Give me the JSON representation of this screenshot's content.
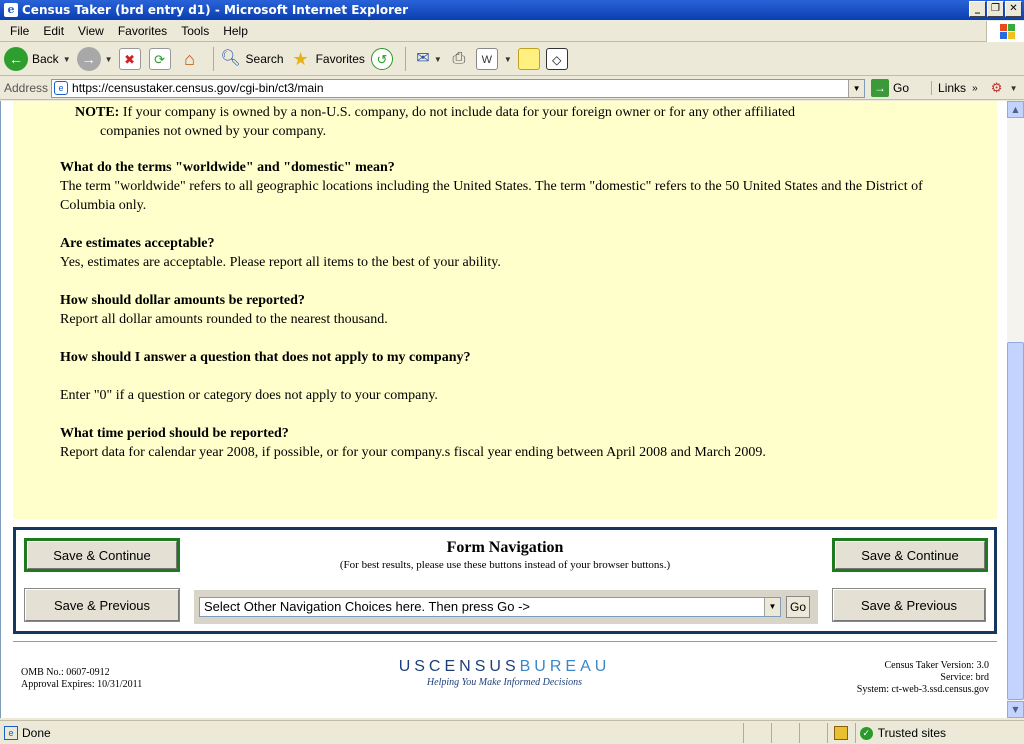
{
  "window": {
    "title": "Census Taker (brd entry d1) - Microsoft Internet Explorer",
    "controls": {
      "minimize": "_",
      "restore": "❐",
      "close": "✕"
    }
  },
  "menu": [
    {
      "label": "File"
    },
    {
      "label": "Edit"
    },
    {
      "label": "View"
    },
    {
      "label": "Favorites"
    },
    {
      "label": "Tools"
    },
    {
      "label": "Help"
    }
  ],
  "toolbar": {
    "back": "Back",
    "search": "Search",
    "favorites": "Favorites"
  },
  "address": {
    "label": "Address",
    "url": "https://censustaker.census.gov/cgi-bin/ct3/main",
    "go": "Go",
    "links": "Links"
  },
  "content": {
    "note_label": "NOTE:",
    "note_text": "If your company is owned by a non-U.S. company, do not include data for your foreign owner or for any other affiliated",
    "note_text2": "companies not owned by your company.",
    "qa": [
      {
        "q": "What do the terms \"worldwide\" and \"domestic\" mean?",
        "a": "The term \"worldwide\" refers to all geographic locations including the United States. The term \"domestic\" refers to the 50 United States and the District of Columbia only."
      },
      {
        "q": "Are estimates acceptable?",
        "a": "Yes, estimates are acceptable. Please report all items to the best of your ability."
      },
      {
        "q": "How should dollar amounts be reported?",
        "a": "Report all dollar amounts rounded to the nearest thousand."
      },
      {
        "q": "How should I answer a question that does not apply to my company?",
        "a": "Enter \"0\" if a question or category does not apply to your company."
      },
      {
        "q": "What time period should be reported?",
        "a": "Report data for calendar year 2008, if possible, or for your company.s fiscal year ending between April 2008 and March 2009."
      }
    ]
  },
  "form_nav": {
    "title": "Form Navigation",
    "subtitle": "(For best results, please use these buttons instead of your browser buttons.)",
    "save_continue": "Save & Continue",
    "save_previous": "Save & Previous",
    "select_value": "Select Other Navigation Choices here. Then press Go ->",
    "go": "Go"
  },
  "footer": {
    "omb": "OMB No.: 0607-0912",
    "approval": "Approval Expires: 10/31/2011",
    "logo_us": "USCENSUS",
    "logo_bureau": "BUREAU",
    "tagline": "Helping You Make Informed Decisions",
    "version": "Census Taker Version: 3.0",
    "service": "Service: brd",
    "system": "System: ct-web-3.ssd.census.gov"
  },
  "status": {
    "text": "Done",
    "zone": "Trusted sites"
  },
  "colors": {
    "content_bg": "#ffffcc",
    "nav_border": "#17365d",
    "green_border": "#1e7a1e"
  }
}
